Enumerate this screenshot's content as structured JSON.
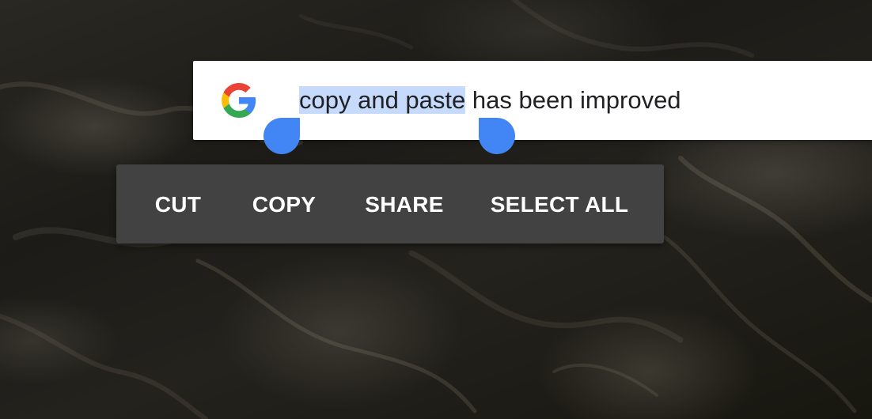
{
  "search": {
    "logo_icon": "google-g-logo",
    "selected_text": "copy and paste",
    "remaining_text": " has been improved",
    "selection_color": "#c6dafc",
    "handle_color": "#4285f4"
  },
  "context_menu": {
    "items": [
      {
        "label": "CUT"
      },
      {
        "label": "COPY"
      },
      {
        "label": "SHARE"
      },
      {
        "label": "SELECT ALL"
      }
    ],
    "background_color": "#424242"
  }
}
